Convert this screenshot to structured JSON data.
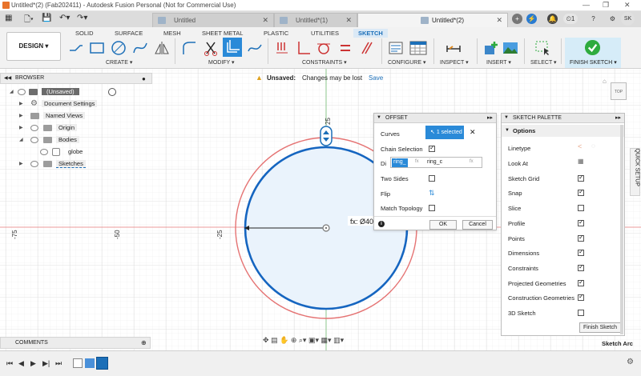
{
  "window": {
    "title": "Untitled*(2) (Fab202411) - Autodesk Fusion Personal (Not for Commercial Use)"
  },
  "tabs": [
    {
      "label": "Untitled",
      "active": false
    },
    {
      "label": "Untitled*(1)",
      "active": false
    },
    {
      "label": "Untitled*(2)",
      "active": true
    }
  ],
  "user": {
    "initials": "SK",
    "job_count": "1"
  },
  "toolbar": {
    "workspace": "DESIGN",
    "workspace_tabs": [
      "SOLID",
      "SURFACE",
      "MESH",
      "SHEET METAL",
      "PLASTIC",
      "UTILITIES",
      "SKETCH"
    ],
    "groups": [
      "CREATE",
      "MODIFY",
      "CONSTRAINTS",
      "CONFIGURE",
      "INSPECT",
      "INSERT",
      "SELECT",
      "FINISH SKETCH"
    ]
  },
  "unsaved": {
    "label": "Unsaved:",
    "message": "Changes may be lost",
    "save": "Save"
  },
  "browser": {
    "title": "BROWSER",
    "items": [
      {
        "label": "(Unsaved)"
      },
      {
        "label": "Document Settings"
      },
      {
        "label": "Named Views"
      },
      {
        "label": "Origin"
      },
      {
        "label": "Bodies"
      },
      {
        "label": "globe"
      },
      {
        "label": "Sketches"
      }
    ]
  },
  "viewcube": {
    "label": "TOP"
  },
  "canvas": {
    "ruler_top": "25",
    "ruler_left": [
      "-75",
      "-50",
      "-25"
    ],
    "dimension": "fx: Ø40"
  },
  "offset": {
    "title": "OFFSET",
    "curves_label": "Curves",
    "curves_value": "1 selected",
    "chain_label": "Chain Selection",
    "chain_on": true,
    "dist_label": "Di",
    "dist_value1": "ring_",
    "dist_fx": "fx",
    "dist_value2": "ring_c",
    "two_sides_label": "Two Sides",
    "flip_label": "Flip",
    "match_label": "Match Topology",
    "ok": "OK",
    "cancel": "Cancel"
  },
  "palette": {
    "title": "SKETCH PALETTE",
    "section": "Options",
    "rows": [
      {
        "label": "Linetype",
        "kind": "icons"
      },
      {
        "label": "Look At",
        "kind": "icon"
      },
      {
        "label": "Sketch Grid",
        "checked": true
      },
      {
        "label": "Snap",
        "checked": true
      },
      {
        "label": "Slice",
        "checked": false
      },
      {
        "label": "Profile",
        "checked": true
      },
      {
        "label": "Points",
        "checked": true
      },
      {
        "label": "Dimensions",
        "checked": true
      },
      {
        "label": "Constraints",
        "checked": true
      },
      {
        "label": "Projected Geometries",
        "checked": true
      },
      {
        "label": "Construction Geometries",
        "checked": true
      },
      {
        "label": "3D Sketch",
        "checked": false
      }
    ],
    "finish": "Finish Sketch"
  },
  "side": {
    "quick_setup": "QUICK SETUP"
  },
  "comments": {
    "title": "COMMENTS"
  },
  "status": {
    "text": "Sketch Arc"
  },
  "colors": {
    "accent": "#1c6fb8",
    "sketch_blue": "#1565c0",
    "offset_red": "#e57373",
    "finish_green": "#2eab3e"
  }
}
